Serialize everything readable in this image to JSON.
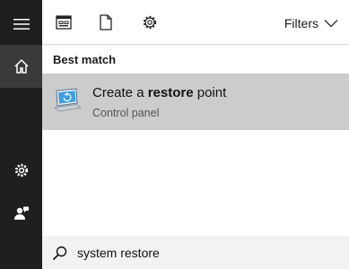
{
  "toolbar": {
    "filters_label": "Filters"
  },
  "icons": {
    "hamburger": "hamburger-menu-icon",
    "home": "home-icon",
    "settings": "gear-icon",
    "feedback": "feedback-person-icon",
    "apps": "apps-window-icon",
    "documents": "document-icon",
    "web": "gear-icon",
    "filter_chevron": "chevron-down-icon",
    "search": "search-icon",
    "result": "system-restore-icon"
  },
  "results": {
    "section_title": "Best match",
    "best_match": {
      "title_before": "Create a ",
      "title_bold": "restore",
      "title_after": " point",
      "subtitle": "Control panel"
    }
  },
  "search": {
    "value": "system restore"
  },
  "colors": {
    "rail_bg": "#1f1f1f",
    "rail_selected_bg": "#3a3a3a",
    "result_selected_bg": "#cccccc",
    "search_bg": "#f2f2f2",
    "accent": "#2b8fd6"
  }
}
